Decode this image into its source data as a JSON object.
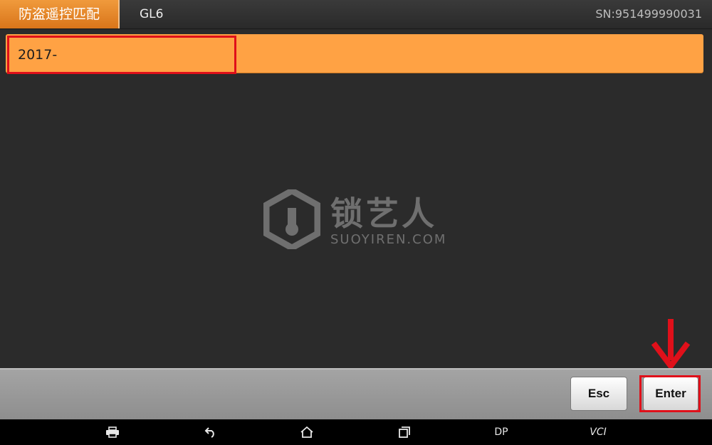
{
  "header": {
    "title": "防盗遥控匹配",
    "model": "GL6",
    "serial": "SN:951499990031"
  },
  "list": {
    "items": [
      {
        "label": "2017-"
      }
    ]
  },
  "watermark": {
    "brand_cn": "锁艺人",
    "brand_en": "SUOYIREN.COM"
  },
  "actions": {
    "esc_label": "Esc",
    "enter_label": "Enter"
  },
  "navbar": {
    "dp_label": "DP",
    "vci_label": "VCI",
    "icons": [
      "print-icon",
      "back-icon",
      "home-icon",
      "recent-apps-icon"
    ]
  },
  "colors": {
    "accent": "#ffa244",
    "highlight": "#e0101a",
    "background": "#2b2b2b"
  }
}
